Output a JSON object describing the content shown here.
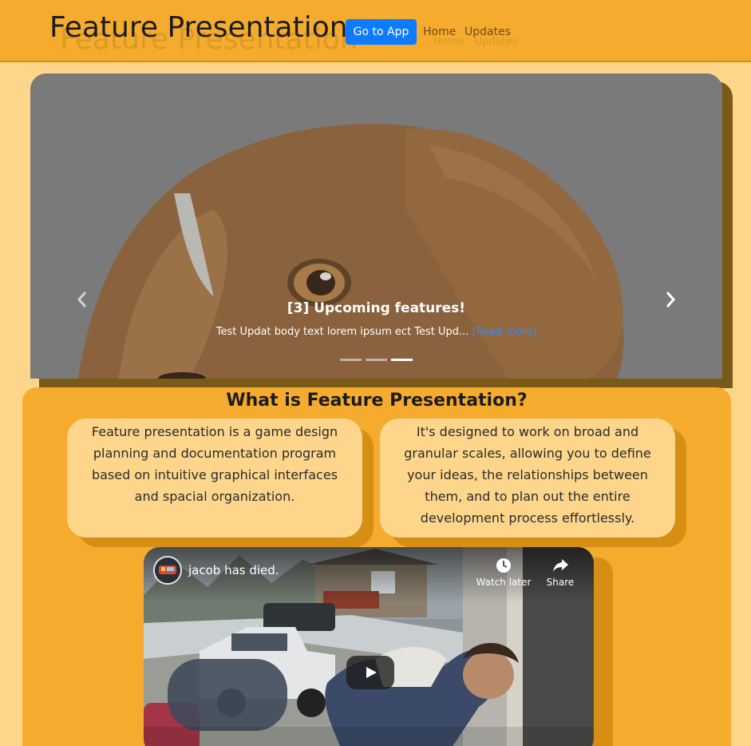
{
  "header": {
    "brand": "Feature Presentation",
    "app_button": "Go to App",
    "nav": [
      {
        "label": "Home"
      },
      {
        "label": "Updates"
      }
    ]
  },
  "carousel": {
    "title": "[3] Upcoming features!",
    "body": "Test Updat body text lorem ipsum ect Test Upd...",
    "read_more": "[Read more]",
    "slide_count": 3,
    "active_slide": 3,
    "prev_icon": "chevron-left-icon",
    "next_icon": "chevron-right-icon"
  },
  "about": {
    "title": "What is Feature Presentation?",
    "cards": [
      {
        "text": "Feature presentation is a game design planning and documentation program based on intuitive graphical interfaces and spacial organization."
      },
      {
        "text": "It's designed to work on broad and granular scales, allowing you to define your ideas, the relationships between them, and to plan out the entire development process effortlessly."
      }
    ]
  },
  "video": {
    "title": "jacob has died.",
    "watch_later": "Watch later",
    "share": "Share"
  },
  "colors": {
    "header_bg": "#f5ac2e",
    "page_bg": "#fdd68c",
    "button_blue": "#0d7bff",
    "link_blue": "#2f8cff",
    "card_shadow": "#d68f14"
  }
}
